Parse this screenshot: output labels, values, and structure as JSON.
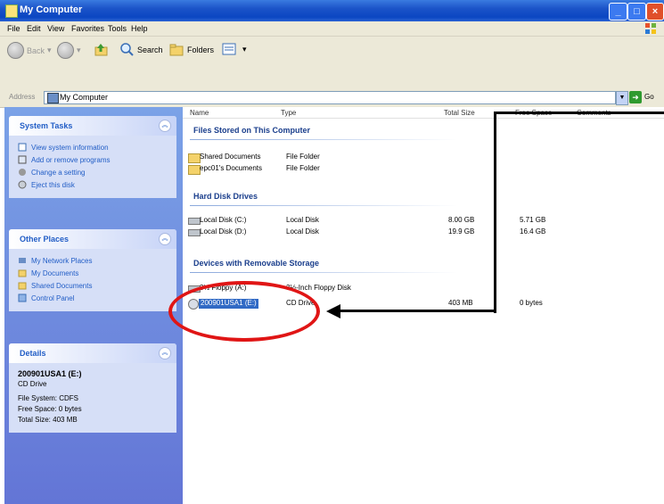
{
  "window": {
    "title": "My Computer"
  },
  "menu": [
    "File",
    "Edit",
    "View",
    "Favorites",
    "Tools",
    "Help"
  ],
  "toolbar": {
    "back": "Back",
    "search": "Search",
    "folders": "Folders"
  },
  "address": {
    "label": "Address",
    "value": "My Computer",
    "go": "Go"
  },
  "system_tasks": {
    "title": "System Tasks",
    "items": [
      "View system information",
      "Add or remove programs",
      "Change a setting",
      "Eject this disk"
    ]
  },
  "other_places": {
    "title": "Other Places",
    "items": [
      "My Network Places",
      "My Documents",
      "Shared Documents",
      "Control Panel"
    ]
  },
  "details": {
    "title": "Details",
    "name": "200901USA1 (E:)",
    "type": "CD Drive",
    "fs": "File System: CDFS",
    "free": "Free Space: 0 bytes",
    "total": "Total Size: 403 MB"
  },
  "columns": {
    "name": "Name",
    "type": "Type",
    "total": "Total Size",
    "free": "Free Space",
    "comments": "Comments"
  },
  "groups": {
    "files": "Files Stored on This Computer",
    "hdd": "Hard Disk Drives",
    "removable": "Devices with Removable Storage"
  },
  "files": [
    {
      "name": "Shared Documents",
      "type": "File Folder"
    },
    {
      "name": "epc01's Documents",
      "type": "File Folder"
    }
  ],
  "disks": [
    {
      "name": "Local Disk (C:)",
      "type": "Local Disk",
      "total": "8.00 GB",
      "free": "5.71 GB"
    },
    {
      "name": "Local Disk (D:)",
      "type": "Local Disk",
      "total": "19.9 GB",
      "free": "16.4 GB"
    }
  ],
  "removable": [
    {
      "name": "3½ Floppy (A:)",
      "type": "3½-Inch Floppy Disk",
      "total": "",
      "free": ""
    },
    {
      "name": "200901USA1 (E:)",
      "type": "CD Drive",
      "total": "403 MB",
      "free": "0 bytes"
    }
  ]
}
